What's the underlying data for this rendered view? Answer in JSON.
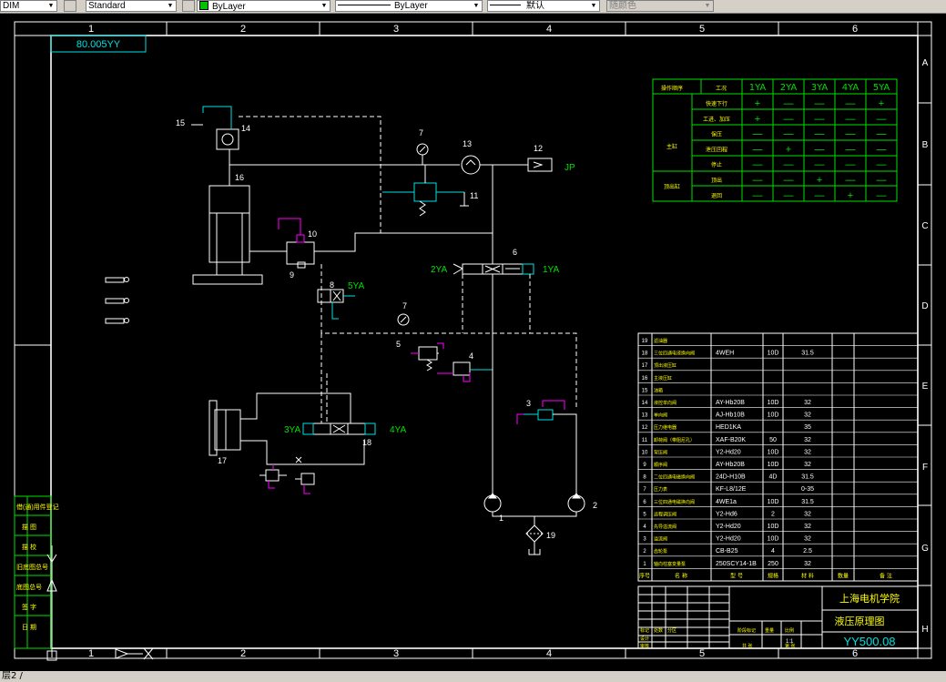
{
  "toolbar": {
    "dimstyle": "DIM",
    "textstyle": "Standard",
    "layer": "ByLayer",
    "linetype": "ByLayer",
    "lineweight": "默认",
    "plotstyle": "随颜色",
    "layer_color": "#00c000"
  },
  "status": {
    "command_text": "层2 /"
  },
  "drawing": {
    "grid_columns": [
      "1",
      "2",
      "3",
      "4",
      "5",
      "6"
    ],
    "grid_rows": [
      "A",
      "B",
      "C",
      "D",
      "E",
      "F",
      "G",
      "H"
    ],
    "stamp": "YY500.08",
    "stamp_mirror": "80.005YY",
    "labels": {
      "n1": "1",
      "n2": "2",
      "n3": "3",
      "n4": "4",
      "n5": "5",
      "n6": "6",
      "n7a": "7",
      "n7b": "7",
      "n8": "8",
      "n9": "9",
      "n10": "10",
      "n11": "11",
      "n12": "12",
      "n13": "13",
      "n14": "14",
      "n15": "15",
      "n16": "16",
      "n17": "17",
      "n18": "18",
      "n19": "19",
      "jp": "JP",
      "v1ya": "1YA",
      "v2ya": "2YA",
      "v3ya": "3YA",
      "v4ya": "4YA",
      "v5ya": "5YA"
    },
    "action_table": {
      "header": [
        "操作顺序",
        "工况",
        "1YA",
        "2YA",
        "3YA",
        "4YA",
        "5YA"
      ],
      "groups": [
        {
          "label": "主缸",
          "span": 5
        },
        {
          "label": "顶出缸",
          "span": 2
        }
      ],
      "rows": [
        {
          "op": "快速下行",
          "cells": [
            "+",
            "—",
            "—",
            "—",
            "+"
          ]
        },
        {
          "op": "工进、加压",
          "cells": [
            "+",
            "—",
            "—",
            "—",
            "—"
          ]
        },
        {
          "op": "保压",
          "cells": [
            "—",
            "—",
            "—",
            "—",
            "—"
          ]
        },
        {
          "op": "泄压回程",
          "cells": [
            "—",
            "+",
            "—",
            "—",
            "—"
          ]
        },
        {
          "op": "停止",
          "cells": [
            "—",
            "—",
            "—",
            "—",
            "—"
          ]
        },
        {
          "op": "顶出",
          "cells": [
            "—",
            "—",
            "+",
            "—",
            "—"
          ]
        },
        {
          "op": "退回",
          "cells": [
            "—",
            "—",
            "—",
            "+",
            "—"
          ]
        }
      ]
    },
    "parts_list": {
      "rows": [
        [
          "19",
          "滤油器",
          "",
          "",
          "",
          ""
        ],
        [
          "18",
          "三位四通电液换向阀",
          "4WEH",
          "10D",
          "31.5",
          ""
        ],
        [
          "17",
          "顶出液压缸",
          "",
          "",
          "",
          ""
        ],
        [
          "16",
          "主液压缸",
          "",
          "",
          "",
          ""
        ],
        [
          "15",
          "油箱",
          "",
          "",
          "",
          ""
        ],
        [
          "14",
          "液控单向阀",
          "AY-Hb20B",
          "10D",
          "32",
          ""
        ],
        [
          "13",
          "单向阀",
          "AJ-Hb10B",
          "10D",
          "32",
          ""
        ],
        [
          "12",
          "压力继电器",
          "HED1KA",
          "",
          "35",
          ""
        ],
        [
          "11",
          "卸荷阀（带阻尼孔）",
          "XAF-B20K",
          "50",
          "32",
          ""
        ],
        [
          "10",
          "背压阀",
          "Y2-Hd20",
          "10D",
          "32",
          ""
        ],
        [
          "9",
          "顺序阀",
          "AY-Hb20B",
          "10D",
          "32",
          ""
        ],
        [
          "8",
          "二位四通电磁换向阀",
          "24D-H10B",
          "4D",
          "31.5",
          ""
        ],
        [
          "7",
          "压力表",
          "KF-L8/12E",
          "",
          "0-35",
          ""
        ],
        [
          "6",
          "三位四通电磁换向阀",
          "4WE1a",
          "10D",
          "31.5",
          ""
        ],
        [
          "5",
          "远程调压阀",
          "Y2-Hd6",
          "2",
          "32",
          ""
        ],
        [
          "4",
          "先导溢流阀",
          "Y2-Hd20",
          "10D",
          "32",
          ""
        ],
        [
          "3",
          "溢流阀",
          "Y2-Hd20",
          "10D",
          "32",
          ""
        ],
        [
          "2",
          "齿轮泵",
          "CB-B25",
          "4",
          "2.5",
          ""
        ],
        [
          "1",
          "轴向柱塞变量泵",
          "250SCY14-1B",
          "250",
          "32",
          ""
        ]
      ],
      "header": [
        "序号",
        "名 称",
        "型 号",
        "规格",
        "材 料",
        "数量",
        "备 注"
      ]
    },
    "title_block": {
      "school": "上海电机学院",
      "drawing_name": "液压原理图",
      "small": [
        "标记",
        "处数",
        "分区",
        "更改文件号",
        "签名",
        "年月日",
        "设计",
        "标准化",
        "审核",
        "工艺",
        "批准",
        "阶段标记",
        "重量",
        "比例",
        "共 张",
        "第 张",
        "1:1"
      ]
    },
    "left_strip": [
      "借(通)用件登记",
      "描 图",
      "描 校",
      "旧底图总号",
      "底图总号",
      "签 字",
      "日 期"
    ]
  }
}
